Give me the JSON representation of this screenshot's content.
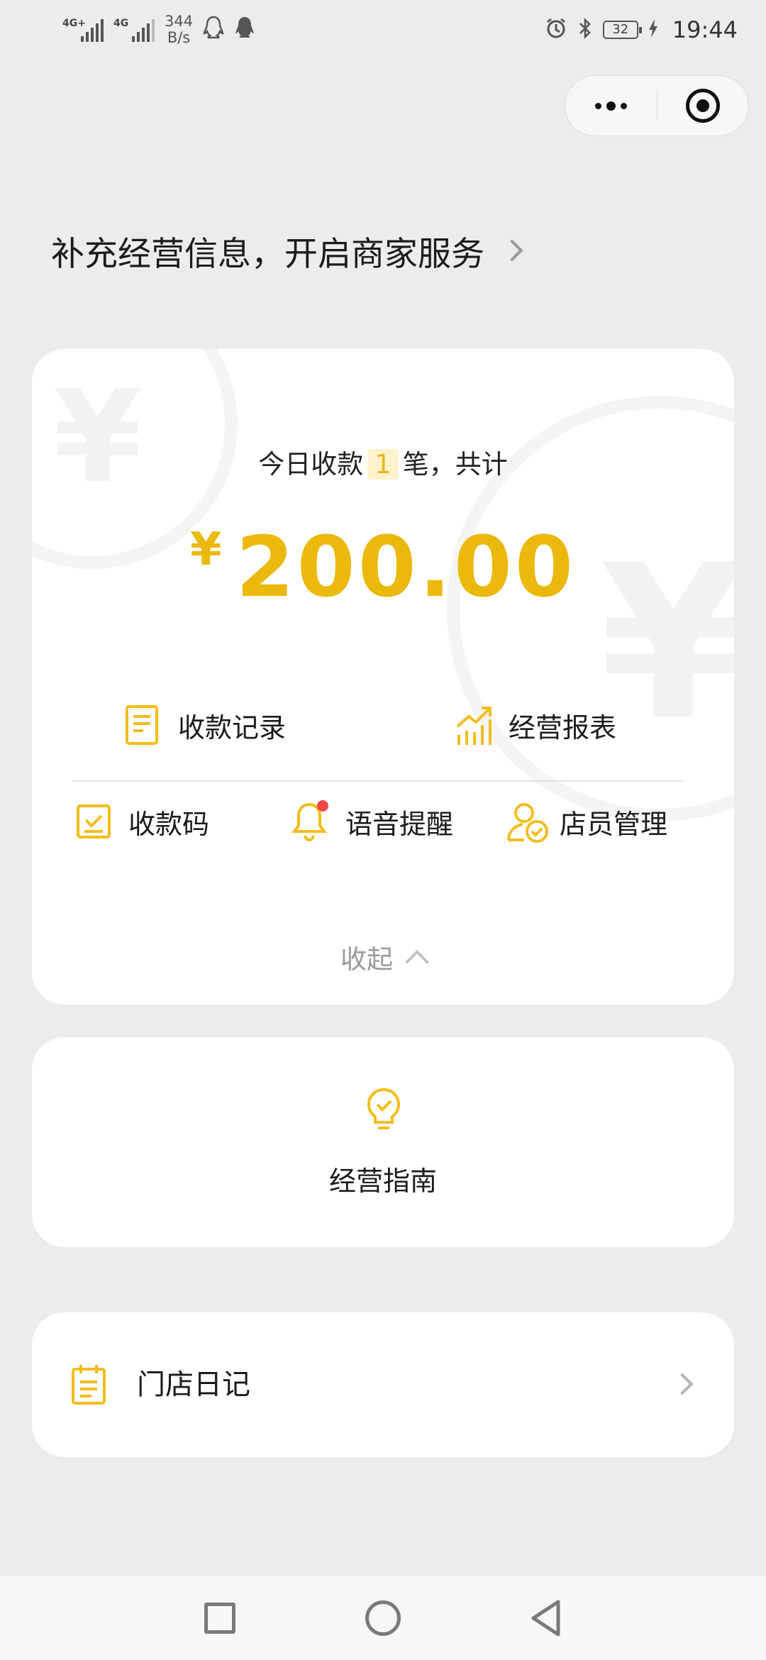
{
  "status_bar": {
    "network1": "4G+",
    "network2": "4G",
    "speed_value": "344",
    "speed_unit": "B/s",
    "battery": "32",
    "time": "19:44"
  },
  "capsule": {
    "more_icon": "more-dots-icon",
    "close_icon": "target-icon"
  },
  "banner": {
    "text": "补充经营信息，开启商家服务"
  },
  "summary": {
    "today_prefix": "今日收款",
    "today_count": "1",
    "today_suffix": "笔，共计",
    "currency": "¥",
    "amount": "200.00"
  },
  "actions": {
    "records": "收款记录",
    "report": "经营报表",
    "qrcode": "收款码",
    "voice": "语音提醒",
    "staff": "店员管理",
    "collapse": "收起"
  },
  "guide": {
    "label": "经营指南"
  },
  "diary": {
    "label": "门店日记"
  },
  "colors": {
    "accent": "#ebb90c",
    "background": "#ececec",
    "badge": "#f04848"
  }
}
